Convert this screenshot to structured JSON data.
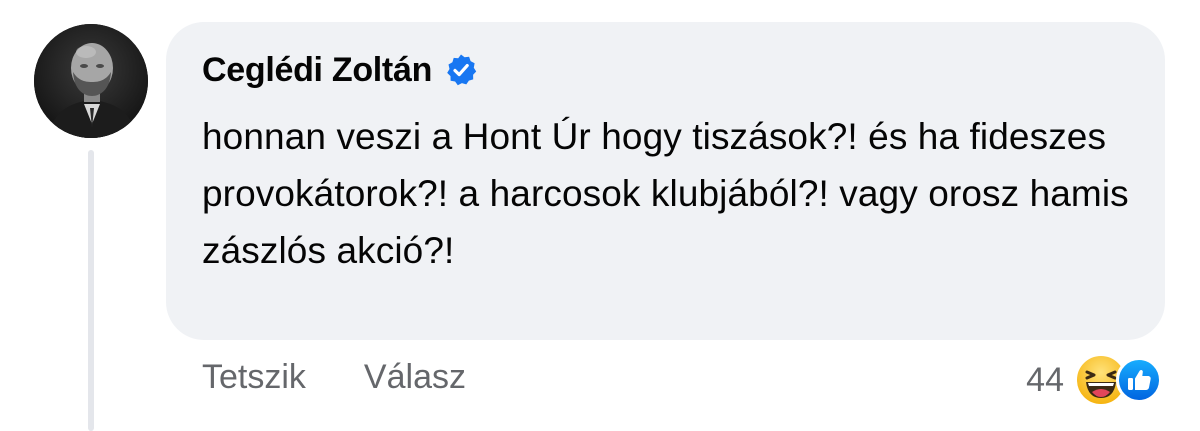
{
  "comment": {
    "author": "Ceglédi Zoltán",
    "verified": true,
    "text": "honnan veszi a Hont Úr hogy tiszások?! és ha fideszes provokátorok?! a harcosok klubjából?! vagy orosz hamis zászlós akció?!",
    "avatar_icon": "profile-photo",
    "verified_icon": "verified-badge-icon"
  },
  "actions": {
    "like_label": "Tetszik",
    "reply_label": "Válasz"
  },
  "reactions": {
    "count": "44",
    "types": [
      "haha",
      "like"
    ]
  },
  "colors": {
    "bubble_bg": "#f0f2f5",
    "secondary_text": "#65676b",
    "verified_blue": "#1877f2",
    "thread_line": "#e4e6eb"
  }
}
